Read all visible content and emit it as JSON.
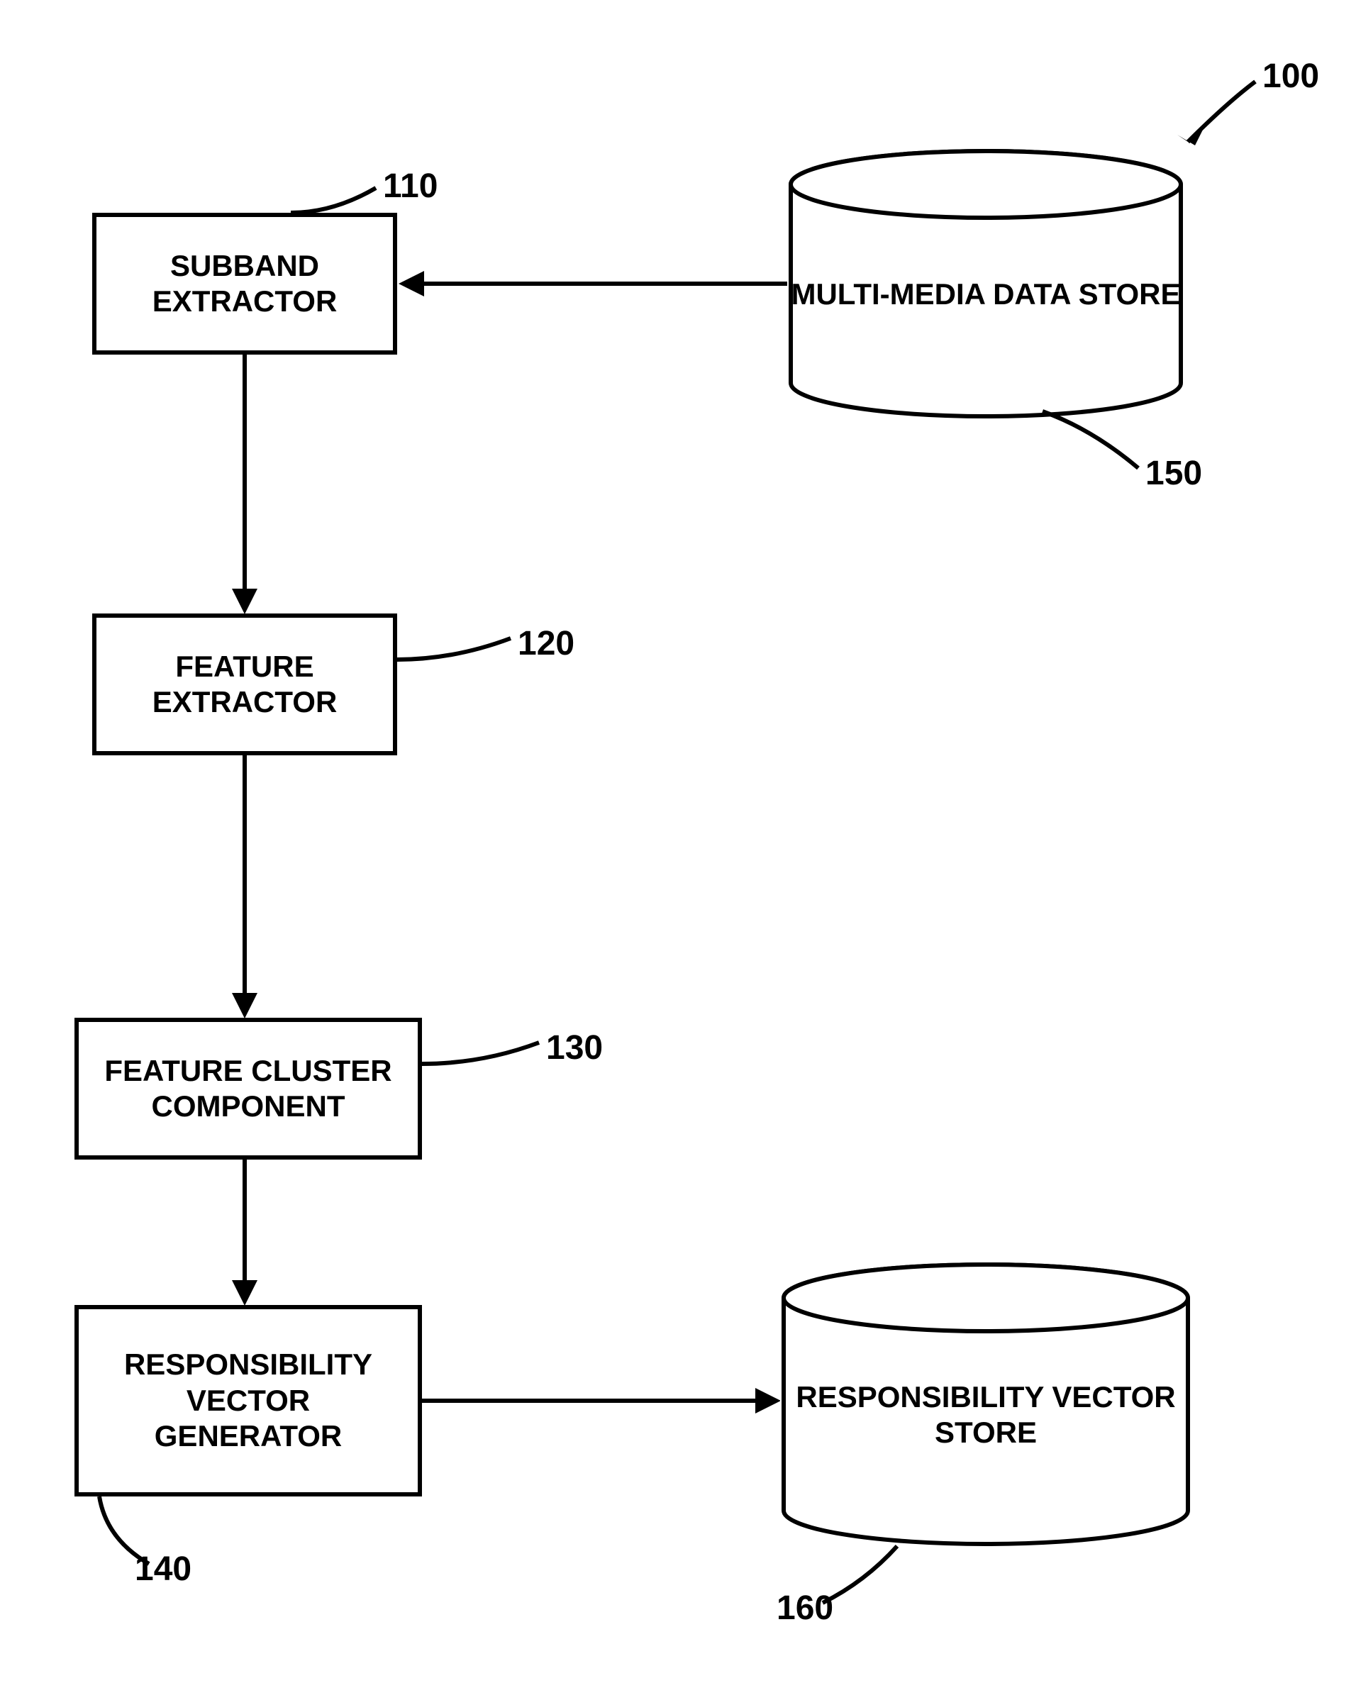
{
  "labels": {
    "system": "100",
    "subband": "110",
    "feature": "120",
    "cluster": "130",
    "generator": "140",
    "datastore": "150",
    "vectorstore": "160"
  },
  "boxes": {
    "subband": "SUBBAND EXTRACTOR",
    "feature": "FEATURE EXTRACTOR",
    "cluster": "FEATURE CLUSTER COMPONENT",
    "generator": "RESPONSIBILITY VECTOR GENERATOR"
  },
  "cylinders": {
    "datastore": "MULTI-MEDIA DATA STORE",
    "vectorstore": "RESPONSIBILITY VECTOR STORE"
  }
}
